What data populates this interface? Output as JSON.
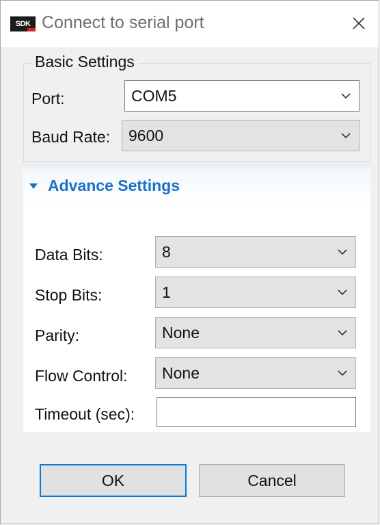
{
  "window": {
    "app_icon_text": "SDK",
    "title": "Connect to serial port",
    "close_glyph": "×"
  },
  "basic_settings": {
    "legend": "Basic Settings",
    "port_label": "Port:",
    "port_value": "COM5",
    "baud_label": "Baud Rate:",
    "baud_value": "9600"
  },
  "advance_settings": {
    "title": "Advance Settings",
    "expanded": true,
    "data_bits_label": "Data Bits:",
    "data_bits_value": "8",
    "stop_bits_label": "Stop Bits:",
    "stop_bits_value": "1",
    "parity_label": "Parity:",
    "parity_value": "None",
    "flow_control_label": "Flow Control:",
    "flow_control_value": "None",
    "timeout_label": "Timeout (sec):",
    "timeout_value": ""
  },
  "buttons": {
    "ok": "OK",
    "cancel": "Cancel"
  },
  "colors": {
    "accent_blue": "#1a72c7",
    "focus_border": "#0a78d7",
    "dialog_bg": "#f0f0f0",
    "combo_bg": "#e3e3e3"
  }
}
